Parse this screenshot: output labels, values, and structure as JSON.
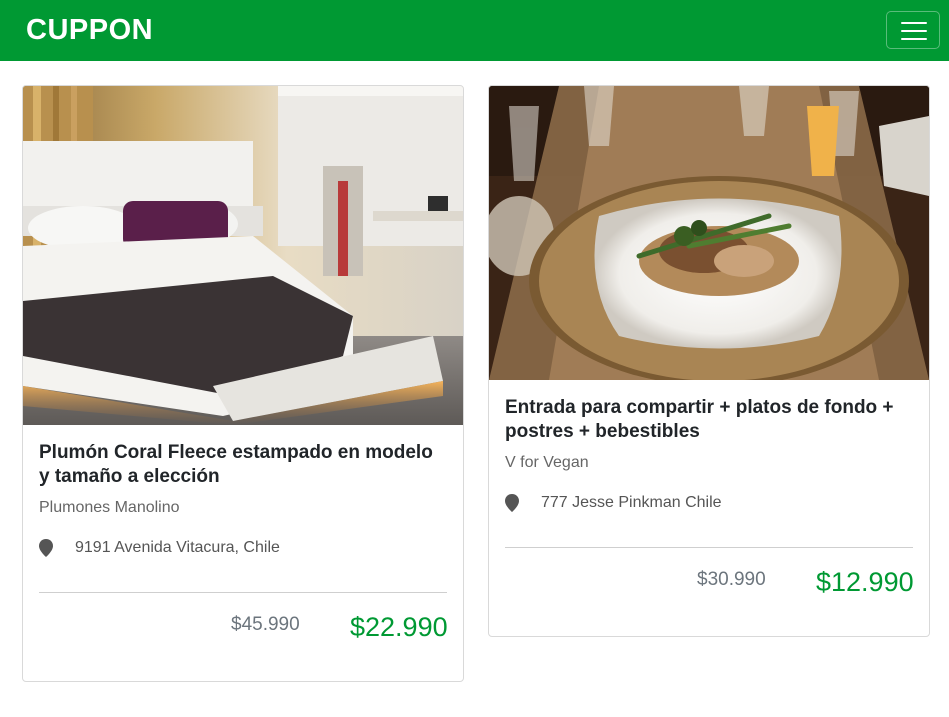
{
  "header": {
    "brand": "CUPPON",
    "menu_icon": "hamburger-menu-icon",
    "background_color": "#009933"
  },
  "deals": [
    {
      "image": "hotel-bed-photo",
      "title": "Plumón Coral Fleece estampado en modelo y tamaño a elección",
      "merchant": "Plumones Manolino",
      "location_icon": "map-pin-icon",
      "address": "9191 Avenida Vitacura, Chile",
      "original_price": "$45.990",
      "sale_price": "$22.990"
    },
    {
      "image": "restaurant-plate-photo",
      "title": "Entrada para compartir + platos de fondo + postres + bebestibles",
      "merchant": "V for Vegan",
      "location_icon": "map-pin-icon",
      "address": "777 Jesse Pinkman Chile",
      "original_price": "$30.990",
      "sale_price": "$12.990"
    }
  ],
  "colors": {
    "price_green": "#009933",
    "muted_text": "#6c757d"
  }
}
